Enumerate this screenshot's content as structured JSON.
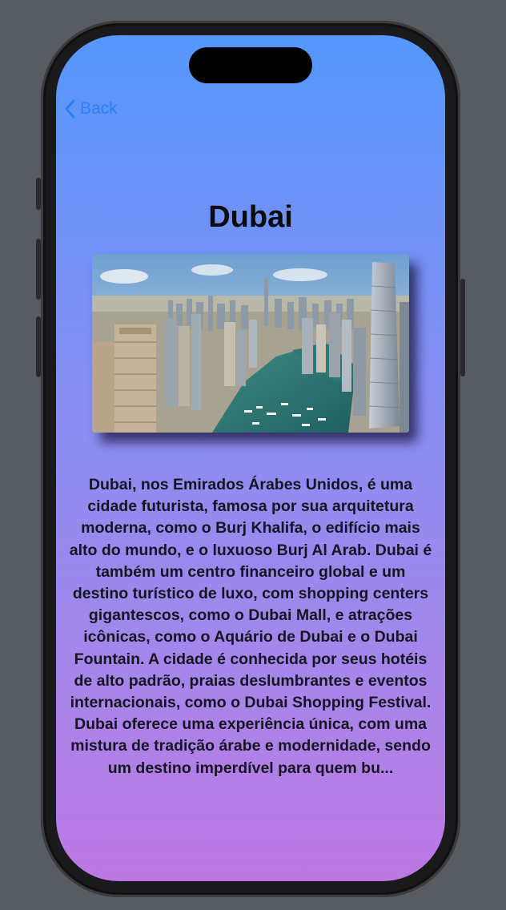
{
  "nav": {
    "back_label": "Back",
    "back_icon": "chevron-left-icon",
    "accent_color": "#2f7ef2"
  },
  "city": {
    "name": "Dubai",
    "image_icon": "dubai-marina-photo",
    "description": "Dubai, nos Emirados Árabes Unidos, é uma cidade futurista, famosa por sua arquitetura moderna, como o Burj Khalifa, o edifício mais alto do mundo, e o luxuoso Burj Al Arab. Dubai é também um centro financeiro global e um destino turístico de luxo, com shopping centers gigantescos, como o Dubai Mall, e atrações icônicas, como o Aquário de Dubai e o Dubai Fountain. A cidade é conhecida por seus hotéis de alto padrão, praias deslumbrantes e eventos internacionais, como o Dubai Shopping Festival. Dubai oferece uma experiência única, com uma mistura de tradição árabe e modernidade, sendo um destino imperdível para quem bu..."
  },
  "theme": {
    "gradient_top": "#5597fb",
    "gradient_bottom": "#be78e4"
  }
}
